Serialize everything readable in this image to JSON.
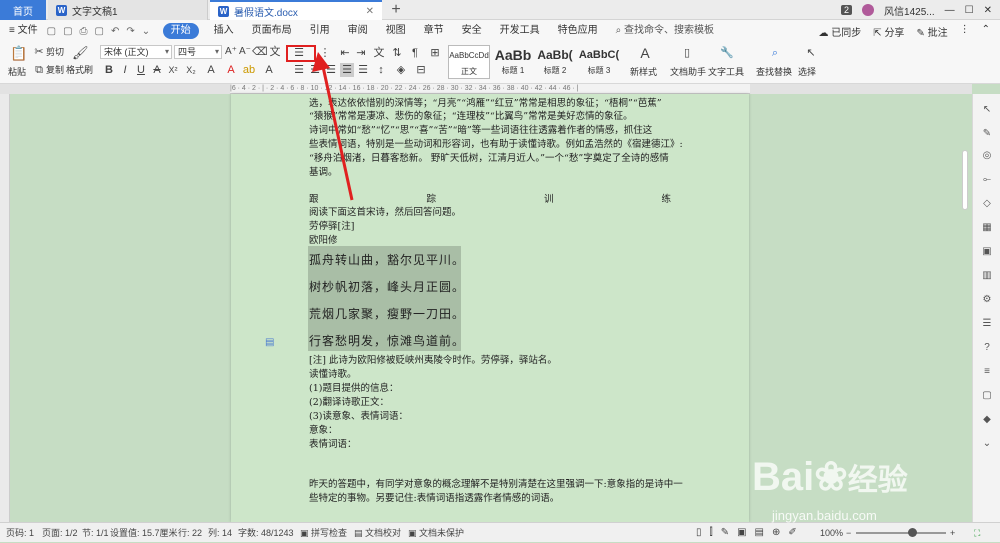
{
  "tabs": {
    "home": "首页",
    "doc1": "文字文稿1",
    "doc2": "暑假语文.docx",
    "add": "+",
    "badge": "2",
    "user": "风信1425..."
  },
  "menu": {
    "file": "≡ 文件",
    "start": "开始",
    "items": [
      "插入",
      "页面布局",
      "引用",
      "审阅",
      "视图",
      "章节",
      "安全",
      "开发工具",
      "特色应用"
    ],
    "search": "查找命令、搜索模板",
    "sync": "已同步",
    "share": "分享",
    "comment": "批注"
  },
  "ribbon": {
    "paste": "粘贴",
    "cut": "剪切",
    "copy": "复制",
    "format_painter": "格式刷",
    "font_name": "宋体 (正文)",
    "font_size": "四号",
    "styles": [
      {
        "preview": "AaBbCcDd",
        "name": "正文"
      },
      {
        "preview": "AaBb",
        "name": "标题 1"
      },
      {
        "preview": "AaBb(",
        "name": "标题 2"
      },
      {
        "preview": "AaBbC(",
        "name": "标题 3"
      }
    ],
    "new_style": "新样式",
    "doc_assistant": "文档助手",
    "text_tools": "文字工具",
    "find_replace": "查找替换",
    "select": "选择"
  },
  "document": {
    "lines": [
      "选，表达依依惜别的深情等；“月亮”“鸿雁”“红豆”常常是相思的象征；“梧桐”“芭蕉”",
      "“猿猴”常常是凄凉、悲伤的象征；“连理枝”“比翼鸟”常常是美好恋情的象征。",
      "诗词中常如“愁”“忆”“思”“喜”“苦”“暗”等一些词语往往透露着作者的情感，抓住这",
      "些表情词语，特别是一些动词和形容词，也有助于读懂诗歌。例如孟浩然的《宿建德江》:",
      "“移舟泊烟渚，日暮客愁新。 野旷天低树，江清月近人。”一个“愁”字奠定了全诗的感情",
      "基调。"
    ],
    "practice_heading": [
      "跟",
      "踪",
      "训",
      "练"
    ],
    "lines2": [
      "阅读下面这首宋诗，然后回答问题。",
      "劳停驿[注]",
      "欧阳修"
    ],
    "poem": [
      "孤舟转山曲，豁尔见平川。",
      "树杪帆初落，峰头月正圆。",
      "荒烟几家聚，瘦野一刀田。",
      "行客愁明发，惊滩鸟道前。"
    ],
    "lines3": [
      "[注] 此诗为欧阳修被贬峡州夷陵令时作。劳停驿，驿站名。",
      "读懂诗歌。",
      "(1)题目提供的信息：",
      "(2)翻译诗歌正文：",
      "(3)读意象、表情词语：",
      "意象：",
      "表情词语："
    ],
    "lines4": [
      "昨天的答题中，有同学对意象的概念理解不是特别清楚在这里强调一下:意象指的是诗中一",
      "些特定的事物。另要记住:表情词语指透露作者情感的词语。"
    ]
  },
  "status": {
    "page_num": "页码: 1",
    "pages": "页面: 1/2",
    "section": "节: 1/1",
    "setting": "设置值: 15.7厘米",
    "row": "行: 22",
    "col": "列: 14",
    "words": "字数: 48/1243",
    "spell": "拼写检查",
    "proof": "文档校对",
    "protect": "文档未保护",
    "zoom": "100%"
  },
  "watermark": {
    "brand": "Bai",
    "brand_cn": "经验",
    "url": "jingyan.baidu.com"
  }
}
